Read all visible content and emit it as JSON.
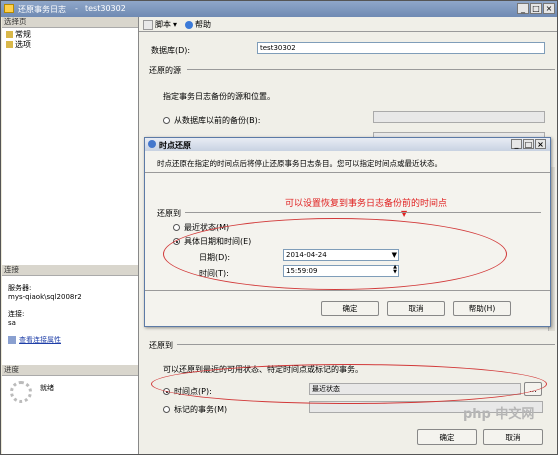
{
  "main_window": {
    "title": "还原事务日志",
    "title_suffix": "test30302",
    "controls": [
      "_",
      "□",
      "×"
    ]
  },
  "left_panel": {
    "select_page_header": "选择页",
    "pages": [
      {
        "label": "常规"
      },
      {
        "label": "选项"
      }
    ],
    "connection_header": "连接",
    "server_label": "服务器:",
    "server_value": "mys-qiaok\\sql2008r2",
    "connection_label": "连接:",
    "connection_value": "sa",
    "view_props_link": "查看连接属性",
    "progress_header": "进度",
    "progress_status": "就绪"
  },
  "toolbar": {
    "script_label": "脚本",
    "help_label": "帮助"
  },
  "main": {
    "database_label": "数据库(D):",
    "database_value": "test30302",
    "source_header": "还原的源",
    "source_desc": "指定事务日志备份的源和位置。",
    "from_backup_label": "从数据库以前的备份(B):",
    "restore_to_header": "还原到",
    "restore_to_desc": "可以还原到最近的可用状态、特定时间点或标记的事务。",
    "point_in_time_label": "时间点(P):",
    "point_in_time_value": "最近状态",
    "marked_tx_label": "标记的事务(M)",
    "browse_label": "...",
    "ok_label": "确定",
    "cancel_label": "取消"
  },
  "dialog": {
    "title": "时点还原",
    "controls": [
      "_",
      "□",
      "×"
    ],
    "desc": "时点还原在指定的时间点后将停止还原事务日志条目。您可以指定时间点或最近状态。",
    "annotation": "可以设置恢复到事务日志备份前的时间点",
    "restore_to_header": "还原到",
    "latest_label": "最近状态(M)",
    "specific_label": "具体日期和时间(E)",
    "date_label": "日期(D):",
    "date_value": "2014-04-24",
    "time_label": "时间(T):",
    "time_value": "15:59:09",
    "ok_label": "确定",
    "cancel_label": "取消",
    "help_label": "帮助(H)"
  },
  "watermark": "php 中文网"
}
